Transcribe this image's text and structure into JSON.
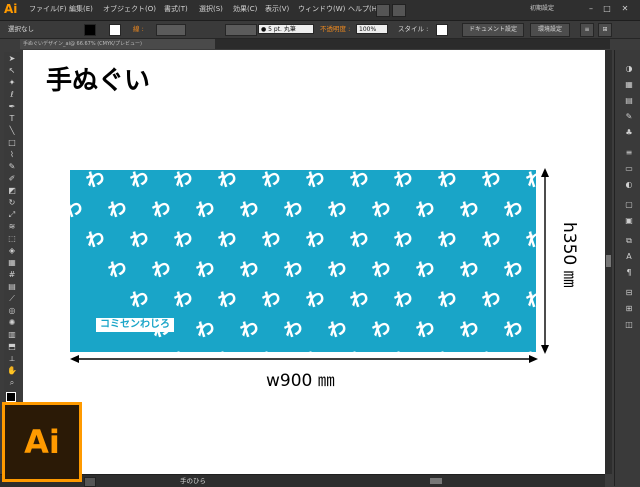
{
  "menubar": {
    "logo": "Ai",
    "items": [
      "ファイル(F)",
      "編集(E)",
      "オブジェクト(O)",
      "書式(T)",
      "選択(S)",
      "効果(C)",
      "表示(V)",
      "ウィンドウ(W)",
      "ヘルプ(H)"
    ],
    "workspace": "初期設定"
  },
  "controlbar": {
    "selection": "選択なし",
    "stroke_label": "線 :",
    "brush": "● 5 pt. 丸筆",
    "opacity_label": "不透明度 :",
    "opacity_value": "100%",
    "style_label": "スタイル :",
    "doc_settings": "ドキュメント設定",
    "prefs": "環境設定"
  },
  "tab": {
    "title": "手ぬぐいデザイン_ai@ 66.67% (CMYK/プレビュー)"
  },
  "artwork": {
    "title": "手ぬぐい",
    "brand": "コミセンわじろ",
    "width_label": "w900 ㎜",
    "height_label": "h350 ㎜",
    "pattern_glyph": "ゎ",
    "towel_color": "#19a5c8"
  },
  "statusbar": {
    "text": "手のひら"
  },
  "big_logo": "Ai",
  "colors": {
    "accent": "#ff9a00",
    "towel": "#19a5c8"
  }
}
